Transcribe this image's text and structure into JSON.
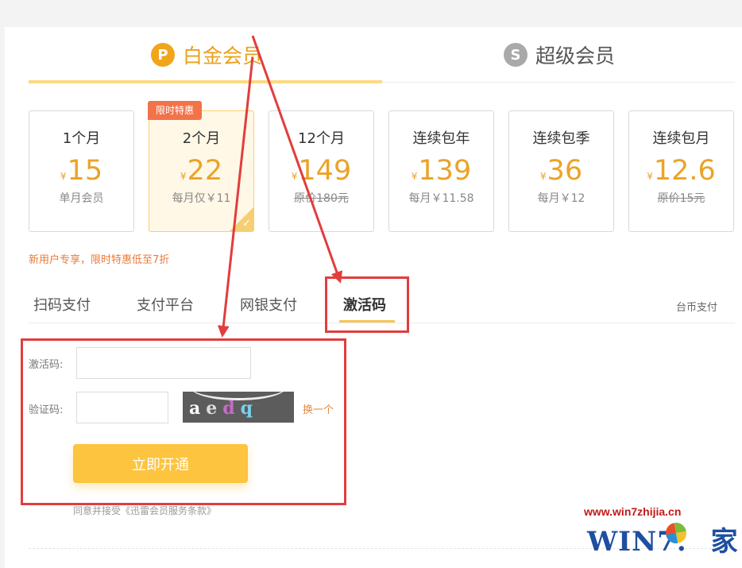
{
  "member_tabs": [
    {
      "label": "白金会员",
      "icon": "platinum-p-icon",
      "badge": "P",
      "active": true
    },
    {
      "label": "超级会员",
      "icon": "super-s-icon",
      "badge": "S",
      "active": false
    }
  ],
  "plans": [
    {
      "duration": "1个月",
      "currency": "¥",
      "price": "15",
      "sub": "单月会员",
      "strike": false
    },
    {
      "duration": "2个月",
      "currency": "¥",
      "price": "22",
      "sub": "每月仅￥11",
      "strike": false,
      "selected": true,
      "promo": "限时特惠"
    },
    {
      "duration": "12个月",
      "currency": "¥",
      "price": "149",
      "sub": "原价180元",
      "strike": true
    },
    {
      "duration": "连续包年",
      "currency": "¥",
      "price": "139",
      "sub": "每月￥11.58",
      "strike": false
    },
    {
      "duration": "连续包季",
      "currency": "¥",
      "price": "36",
      "sub": "每月￥12",
      "strike": false
    },
    {
      "duration": "连续包月",
      "currency": "¥",
      "price": "12.6",
      "sub": "原价15元",
      "strike": true
    }
  ],
  "promo_note": "新用户专享，限时特惠低至7折",
  "payment_tabs": [
    {
      "label": "扫码支付",
      "active": false
    },
    {
      "label": "支付平台",
      "active": false
    },
    {
      "label": "网银支付",
      "active": false
    },
    {
      "label": "激活码",
      "active": true
    }
  ],
  "coin_pay": "台币支付",
  "form": {
    "code_label": "激活码:",
    "code_value": "",
    "captcha_label": "验证码:",
    "captcha_value": "",
    "captcha_chars": [
      "a",
      "e",
      "d",
      "q"
    ],
    "refresh_label": "换一个",
    "submit_label": "立即开通",
    "terms": "同意并接受《迅雷会员服务条款》"
  },
  "watermark": {
    "url": "www.win7zhijia.cn",
    "logo_text": "WIN7.",
    "logo_suffix": "家"
  },
  "colors": {
    "accent": "#eba327",
    "promo": "#f2734a",
    "button": "#fcc43f",
    "annotation": "#e23d3d"
  }
}
